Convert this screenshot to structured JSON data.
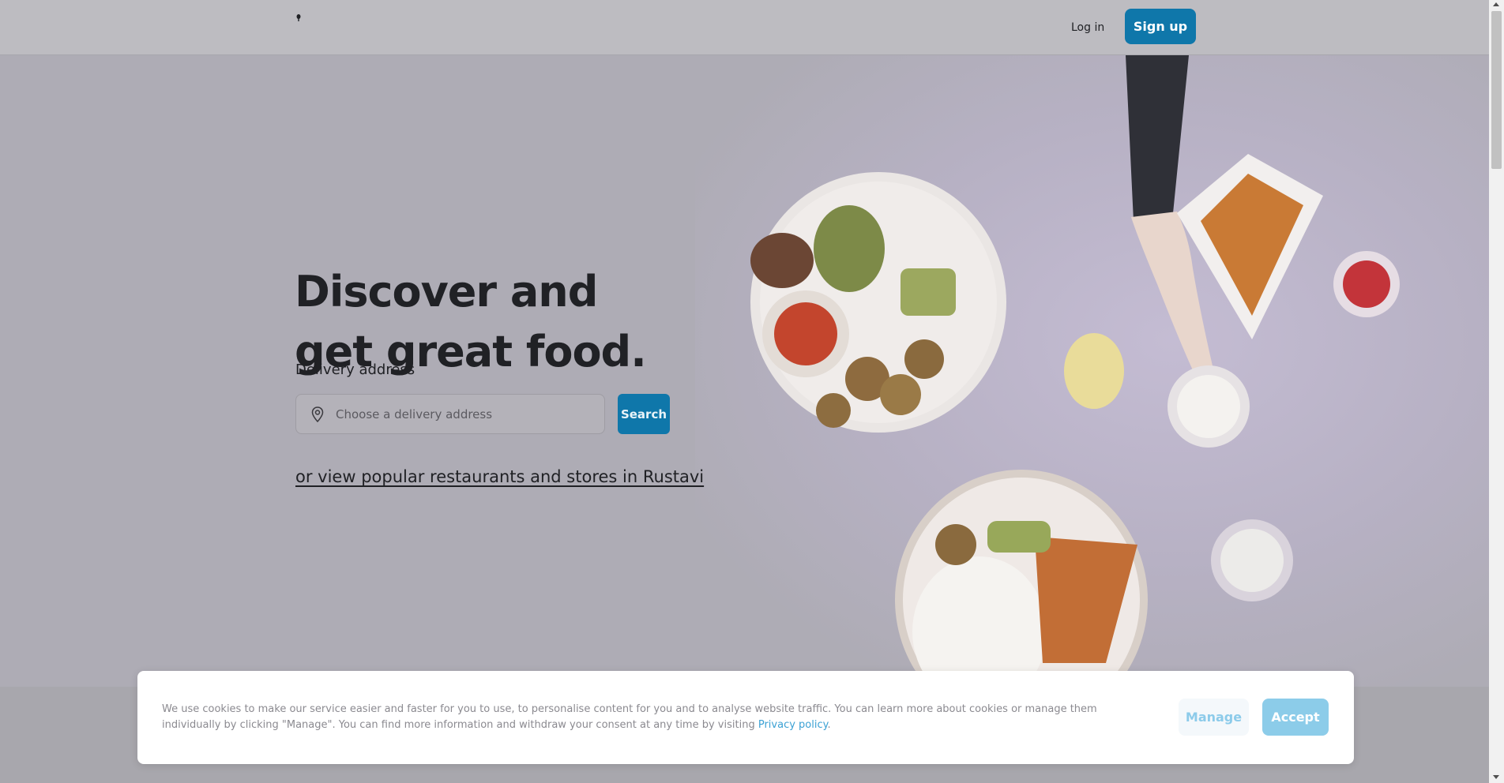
{
  "header": {
    "login_label": "Log in",
    "signup_label": "Sign up"
  },
  "hero": {
    "headline_line1": "Discover and",
    "headline_line2": "get great food.",
    "delivery_label": "Delivery address",
    "address_placeholder": "Choose a delivery address",
    "search_label": "Search",
    "popular_link": "or view popular restaurants and stores in Rustavi"
  },
  "cookie_banner": {
    "text": "We use cookies to make our service easier and faster for you to use, to personalise content for you and to analyse website traffic. You can learn more about cookies or manage them individually by clicking \"Manage\". You can find more information and withdraw your consent at any time by visiting",
    "privacy_link": "Privacy policy",
    "manage_label": "Manage",
    "accept_label": "Accept"
  },
  "icons": {
    "logo": "logo-icon",
    "pin": "location-pin-icon"
  },
  "colors": {
    "brand": "#0f77aa",
    "accept_disabled": "#8ccce9",
    "link": "#3ba1d4",
    "overlay_bg": "#aeacb5"
  }
}
